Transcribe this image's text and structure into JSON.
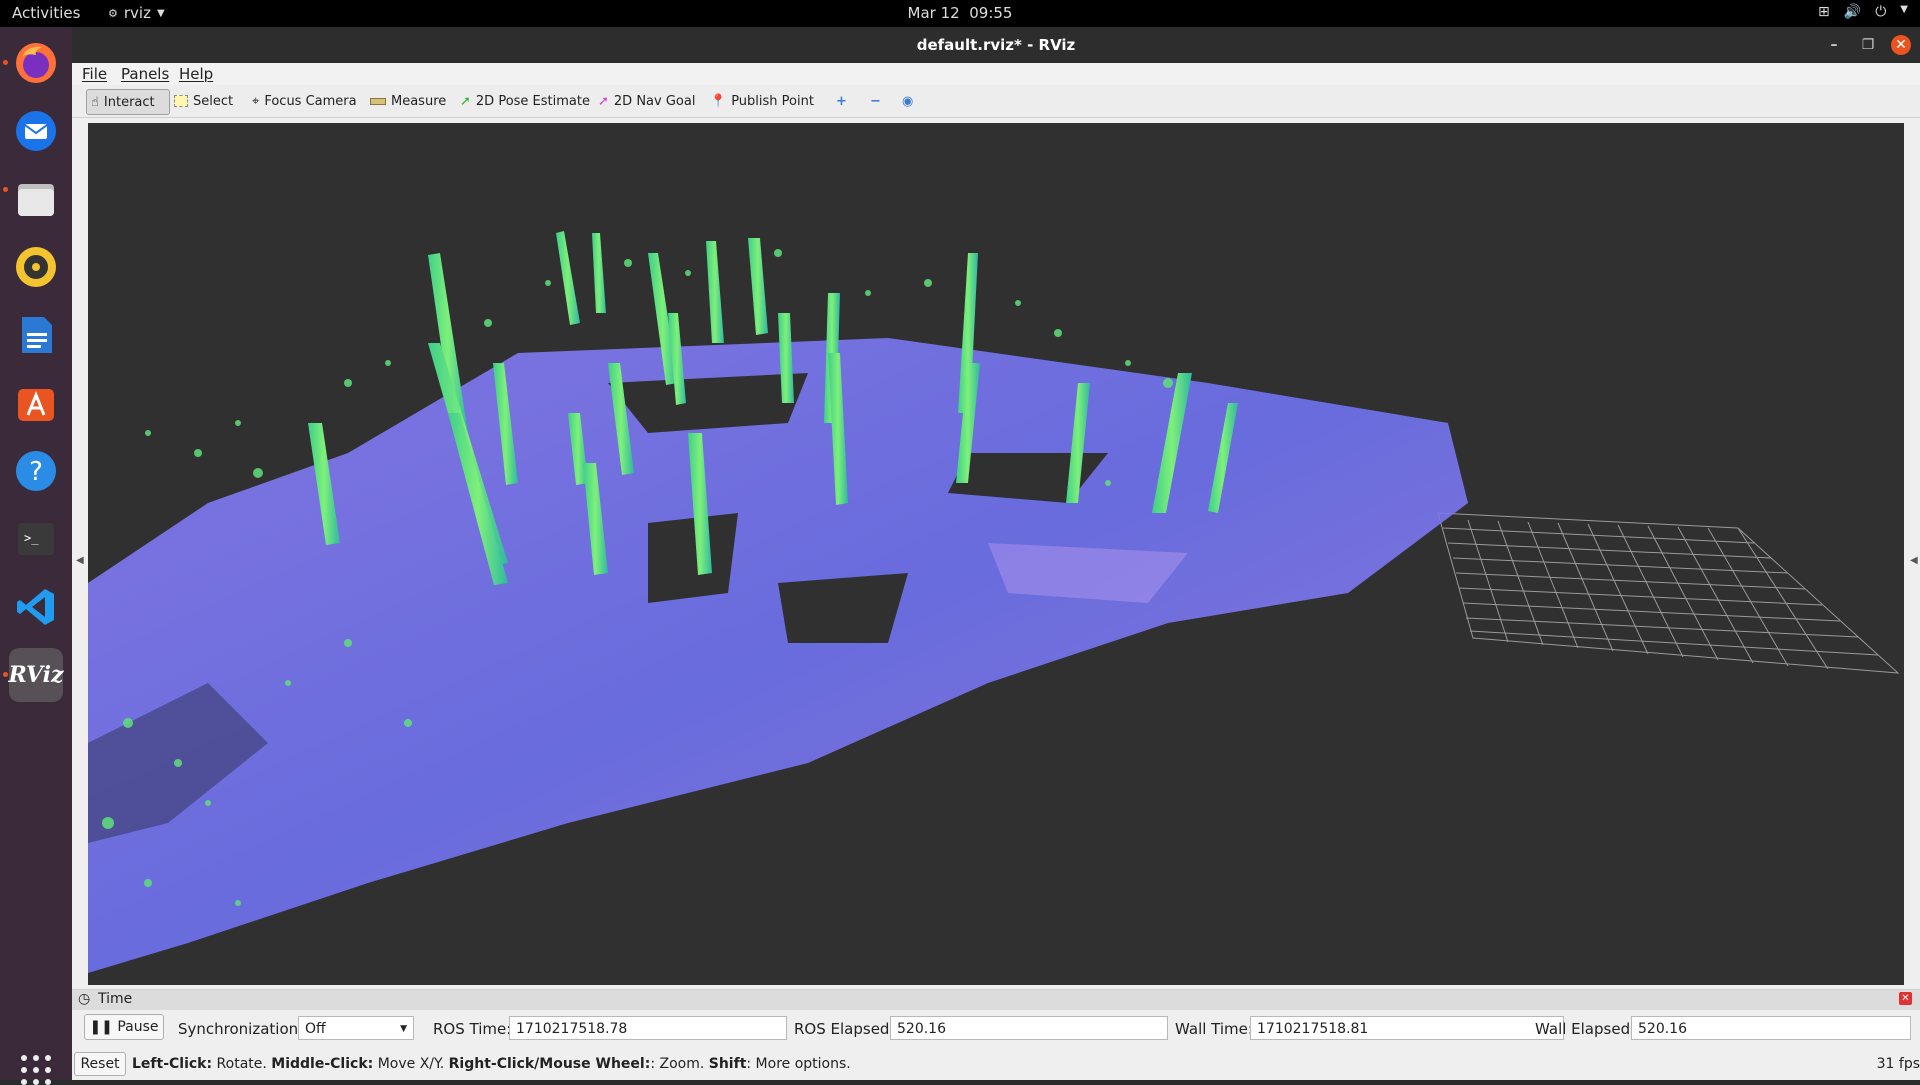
{
  "topbar": {
    "activities": "Activities",
    "app_name": "rviz",
    "date": "Mar 12",
    "time": "09:55"
  },
  "dock": {
    "apps": [
      "firefox-icon",
      "thunderbird-icon",
      "files-icon",
      "rhythmbox-icon",
      "libreoffice-writer-icon",
      "app-center-icon",
      "help-icon",
      "terminal-icon",
      "vscode-icon",
      "rviz-icon"
    ],
    "rviz_label": "RViz"
  },
  "window": {
    "title": "default.rviz* - RViz"
  },
  "menu": {
    "file": "File",
    "panels": "Panels",
    "help": "Help"
  },
  "toolbar": {
    "interact": "Interact",
    "select": "Select",
    "focus_camera": "Focus Camera",
    "measure": "Measure",
    "pose_estimate": "2D Pose Estimate",
    "nav_goal": "2D Nav Goal",
    "publish_point": "Publish Point"
  },
  "time_panel": {
    "title": "Time",
    "pause": "Pause",
    "sync_label": "Synchronization:",
    "sync_value": "Off",
    "ros_time_label": "ROS Time:",
    "ros_time": "1710217518.78",
    "ros_elapsed_label": "ROS Elapsed:",
    "ros_elapsed": "520.16",
    "wall_time_label": "Wall Time:",
    "wall_time": "1710217518.81",
    "wall_elapsed_label": "Wall Elapsed:",
    "wall_elapsed": "520.16"
  },
  "status": {
    "reset": "Reset",
    "left_click_key": "Left-Click:",
    "left_click": " Rotate. ",
    "middle_click_key": "Middle-Click:",
    "middle_click": " Move X/Y. ",
    "right_click_key": "Right-Click/Mouse Wheel:",
    "right_click": ": Zoom. ",
    "shift_key": "Shift",
    "shift": ": More options.",
    "fps": "31 fps"
  },
  "colors": {
    "viewport_bg": "#303030",
    "cloud_floor": "#7b74f0",
    "cloud_trunk": "#4fe07a",
    "grid": "#a0a0a0",
    "ubuntu_orange": "#e95420"
  }
}
